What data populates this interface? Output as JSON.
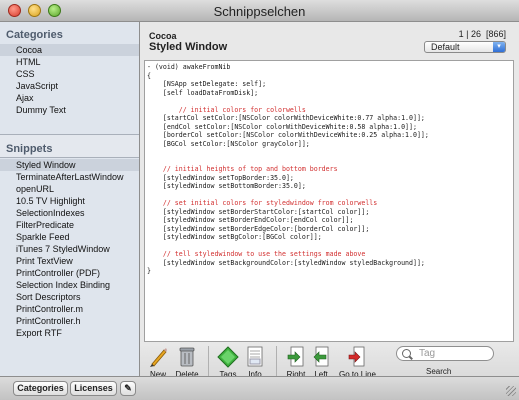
{
  "window": {
    "title": "Schnippselchen"
  },
  "sidebar": {
    "categories_heading": "Categories",
    "categories": [
      {
        "label": "Cocoa",
        "selected": true
      },
      {
        "label": "HTML",
        "selected": false
      },
      {
        "label": "CSS",
        "selected": false
      },
      {
        "label": "JavaScript",
        "selected": false
      },
      {
        "label": "Ajax",
        "selected": false
      },
      {
        "label": "Dummy Text",
        "selected": false
      }
    ],
    "snippets_heading": "Snippets",
    "snippets": [
      {
        "label": "Styled Window",
        "selected": true
      },
      {
        "label": "TerminateAfterLastWindow",
        "selected": false
      },
      {
        "label": "openURL",
        "selected": false
      },
      {
        "label": "10.5 TV Highlight",
        "selected": false
      },
      {
        "label": "SelectionIndexes",
        "selected": false
      },
      {
        "label": "FilterPredicate",
        "selected": false
      },
      {
        "label": "Sparkle Feed",
        "selected": false
      },
      {
        "label": "iTunes 7 StyledWindow",
        "selected": false
      },
      {
        "label": "Print TextView",
        "selected": false
      },
      {
        "label": "PrintController (PDF)",
        "selected": false
      },
      {
        "label": "Selection Index Binding",
        "selected": false
      },
      {
        "label": "Sort Descriptors",
        "selected": false
      },
      {
        "label": "PrintController.m",
        "selected": false
      },
      {
        "label": "PrintController.h",
        "selected": false
      },
      {
        "label": "Export RTF",
        "selected": false
      }
    ]
  },
  "header": {
    "category": "Cocoa",
    "snippet_name": "Styled Window",
    "counter": "1 | 26  [866]",
    "scheme_selected": "Default"
  },
  "code_lines": [
    {
      "text": "- (void) awakeFromNib",
      "comment": false
    },
    {
      "text": "{",
      "comment": false
    },
    {
      "text": "    [NSApp setDelegate: self];",
      "comment": false
    },
    {
      "text": "    [self loadDataFromDisk];",
      "comment": false
    },
    {
      "text": "",
      "comment": false
    },
    {
      "text": "        // initial colors for colorwells",
      "comment": true
    },
    {
      "text": "    [startCol setColor:[NSColor colorWithDeviceWhite:0.77 alpha:1.0]];",
      "comment": false
    },
    {
      "text": "    [endCol setColor:[NSColor colorWithDeviceWhite:0.58 alpha:1.0]];",
      "comment": false
    },
    {
      "text": "    [borderCol setColor:[NSColor colorWithDeviceWhite:0.25 alpha:1.0]];",
      "comment": false
    },
    {
      "text": "    [BGCol setColor:[NSColor grayColor]];",
      "comment": false
    },
    {
      "text": "",
      "comment": false
    },
    {
      "text": "",
      "comment": false
    },
    {
      "text": "    // initial heights of top and bottom borders",
      "comment": true
    },
    {
      "text": "    [styledWindow setTopBorder:35.0];",
      "comment": false
    },
    {
      "text": "    [styledWindow setBottomBorder:35.0];",
      "comment": false
    },
    {
      "text": "",
      "comment": false
    },
    {
      "text": "    // set initial colors for styledwindow from colorwells",
      "comment": true
    },
    {
      "text": "    [styledWindow setBorderStartColor:[startCol color]];",
      "comment": false
    },
    {
      "text": "    [styledWindow setBorderEndColor:[endCol color]];",
      "comment": false
    },
    {
      "text": "    [styledWindow setBorderEdgeColor:[borderCol color]];",
      "comment": false
    },
    {
      "text": "    [styledWindow setBgColor:[BGCol color]];",
      "comment": false
    },
    {
      "text": "",
      "comment": false
    },
    {
      "text": "    // tell styledwindow to use the settings made above",
      "comment": true
    },
    {
      "text": "    [styledWindow setBackgroundColor:[styledWindow styledBackground]];",
      "comment": false
    },
    {
      "text": "}",
      "comment": false
    }
  ],
  "toolbar": {
    "new": "New",
    "delete": "Delete",
    "tags": "Tags",
    "info": "Info",
    "right": "Right",
    "left": "Left",
    "go_to_line": "Go to Line",
    "search_label": "Search",
    "search_placeholder": "Tag"
  },
  "bottom": {
    "categories": "Categories",
    "licenses": "Licenses",
    "edit": "✎"
  },
  "colors": {
    "comment": "#d23030",
    "sidebar_bg": "#dfe5ed",
    "selection": "#cbd2dc"
  }
}
